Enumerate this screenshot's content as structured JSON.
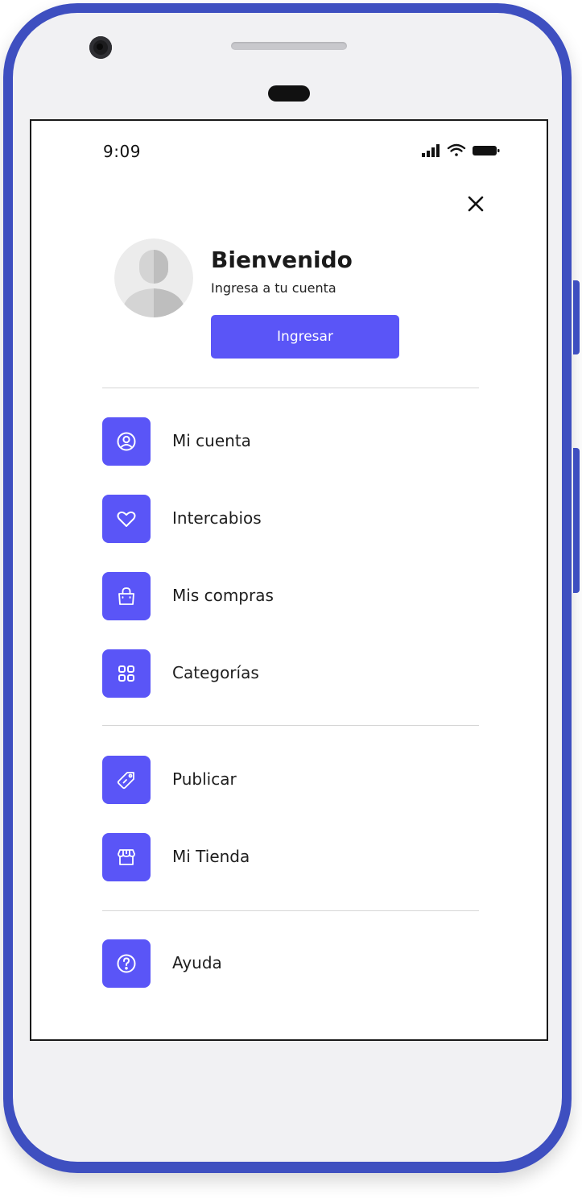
{
  "status_bar": {
    "time": "9:09",
    "icons": [
      "cellular-signal-icon",
      "wifi-icon",
      "battery-icon"
    ]
  },
  "header": {
    "close_icon": "close-icon"
  },
  "profile": {
    "avatar_icon": "default-user-avatar",
    "title": "Bienvenido",
    "subtitle": "Ingresa a tu cuenta",
    "login_button": "Ingresar"
  },
  "menu": {
    "section1": [
      {
        "label": "Mi cuenta",
        "icon": "user-circle-icon"
      },
      {
        "label": "Intercabios",
        "icon": "heart-icon"
      },
      {
        "label": "Mis compras",
        "icon": "shopping-bag-icon"
      },
      {
        "label": "Categorías",
        "icon": "grid-icon"
      }
    ],
    "section2": [
      {
        "label": "Publicar",
        "icon": "price-tag-icon"
      },
      {
        "label": "Mi Tienda",
        "icon": "store-icon"
      }
    ],
    "section3": [
      {
        "label": "Ayuda",
        "icon": "help-icon"
      }
    ]
  },
  "colors": {
    "accent": "#5a55f7",
    "phone_frame": "#3e4fc0",
    "text": "#1e1e1e",
    "divider": "#d6d6d6"
  }
}
